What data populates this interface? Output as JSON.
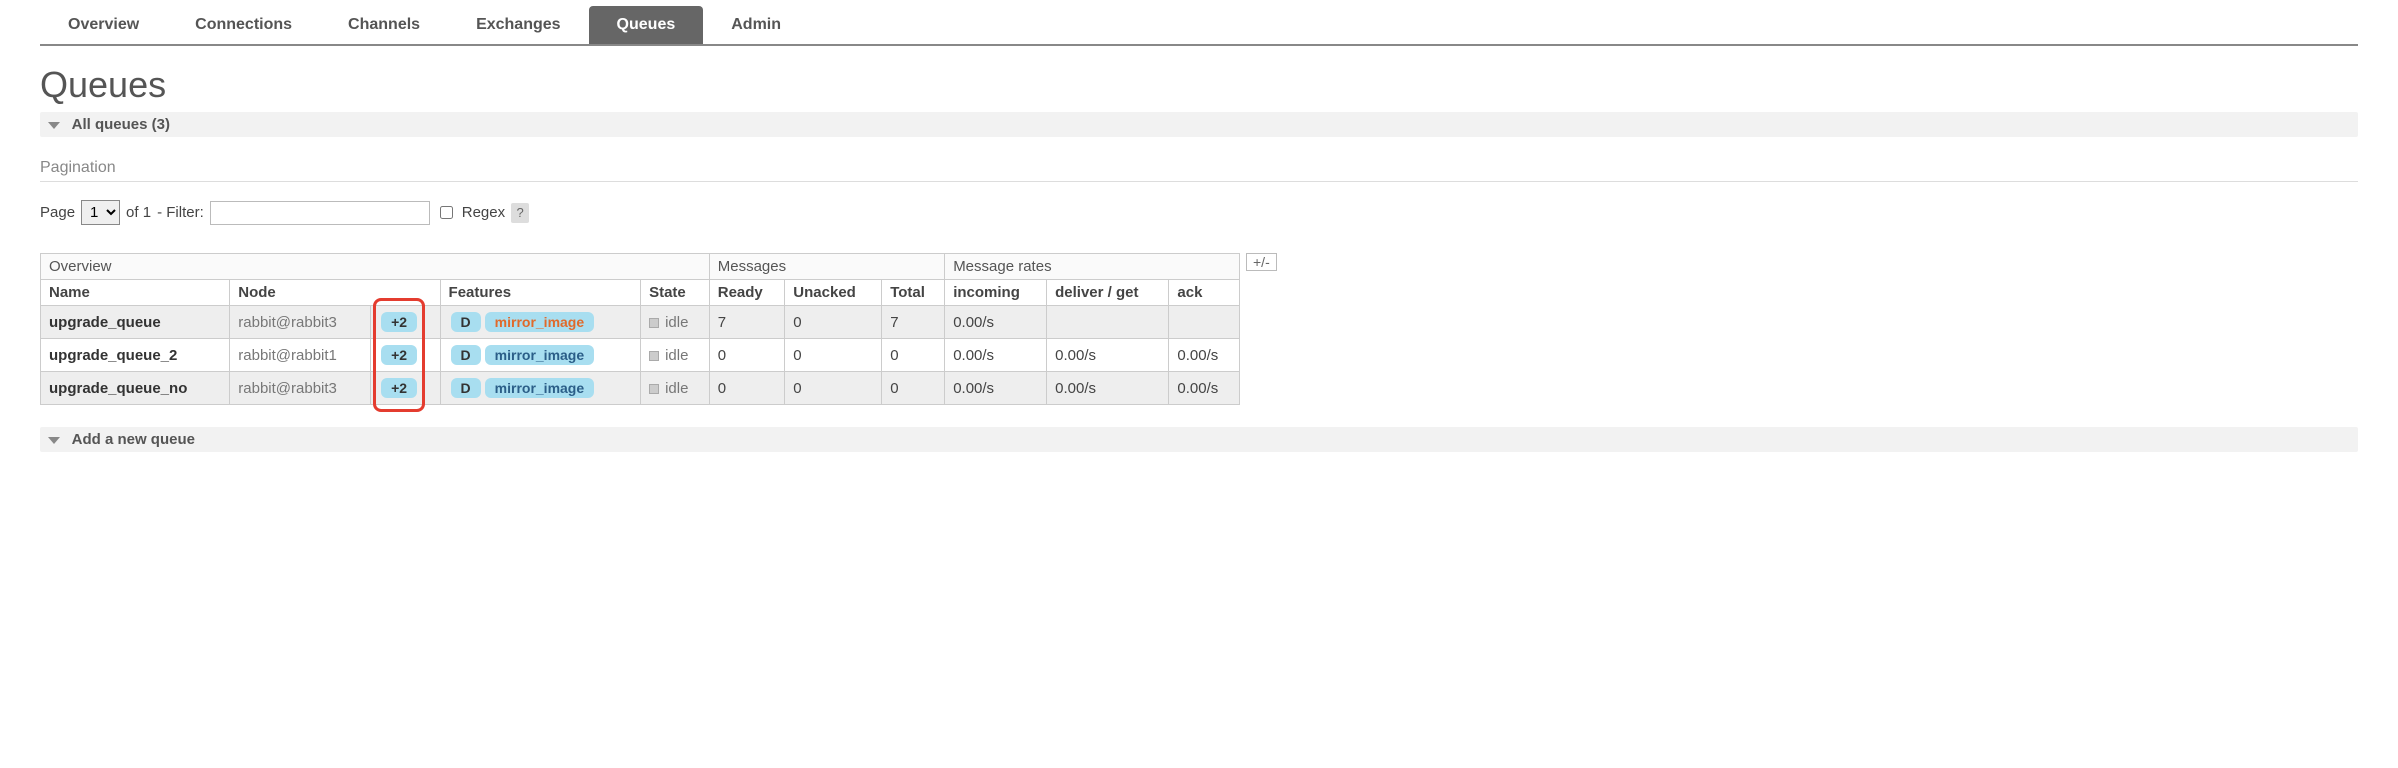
{
  "tabs": [
    "Overview",
    "Connections",
    "Channels",
    "Exchanges",
    "Queues",
    "Admin"
  ],
  "active_tab": "Queues",
  "page_title": "Queues",
  "section_all_queues": "All queues (3)",
  "pagination_label": "Pagination",
  "page_row": {
    "page_label": "Page",
    "page_value": "1",
    "of_label": "of 1",
    "filter_label": "- Filter:",
    "filter_value": "",
    "regex_label": "Regex",
    "help": "?"
  },
  "table": {
    "groups": {
      "overview": "Overview",
      "messages": "Messages",
      "rates": "Message rates",
      "plusminus": "+/-"
    },
    "columns": {
      "name": "Name",
      "node": "Node",
      "features": "Features",
      "state": "State",
      "ready": "Ready",
      "unacked": "Unacked",
      "total": "Total",
      "incoming": "incoming",
      "deliver_get": "deliver / get",
      "ack": "ack"
    },
    "rows": [
      {
        "name": "upgrade_queue",
        "node": "rabbit@rabbit3",
        "replicas": "+2",
        "features": [
          "D",
          "mirror_image"
        ],
        "feature_color": "orange",
        "state": "idle",
        "ready": "7",
        "unacked": "0",
        "total": "7",
        "incoming": "0.00/s",
        "deliver_get": "",
        "ack": ""
      },
      {
        "name": "upgrade_queue_2",
        "node": "rabbit@rabbit1",
        "replicas": "+2",
        "features": [
          "D",
          "mirror_image"
        ],
        "feature_color": "blue",
        "state": "idle",
        "ready": "0",
        "unacked": "0",
        "total": "0",
        "incoming": "0.00/s",
        "deliver_get": "0.00/s",
        "ack": "0.00/s"
      },
      {
        "name": "upgrade_queue_no",
        "node": "rabbit@rabbit3",
        "replicas": "+2",
        "features": [
          "D",
          "mirror_image"
        ],
        "feature_color": "blue",
        "state": "idle",
        "ready": "0",
        "unacked": "0",
        "total": "0",
        "incoming": "0.00/s",
        "deliver_get": "0.00/s",
        "ack": "0.00/s"
      }
    ]
  },
  "add_queue_label": "Add a new queue"
}
